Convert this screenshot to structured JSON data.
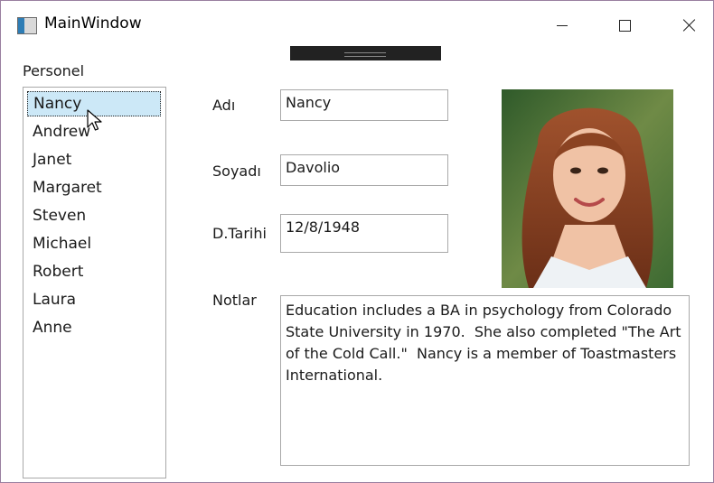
{
  "window": {
    "title": "MainWindow"
  },
  "list": {
    "label": "Personel",
    "items": [
      "Nancy",
      "Andrew",
      "Janet",
      "Margaret",
      "Steven",
      "Michael",
      "Robert",
      "Laura",
      "Anne"
    ],
    "selected_index": 0
  },
  "fields": {
    "first_name_label": "Adı",
    "first_name_value": "Nancy",
    "last_name_label": "Soyadı",
    "last_name_value": "Davolio",
    "birth_date_label": "D.Tarihi",
    "birth_date_value": "12/8/1948",
    "notes_label": "Notlar",
    "notes_value": "Education includes a BA in psychology from Colorado State University in 1970.  She also completed \"The Art of the Cold Call.\"  Nancy is a member of Toastmasters International."
  },
  "icons": {
    "app": "app-icon",
    "minimize": "minimize-icon",
    "maximize": "maximize-icon",
    "close": "close-icon",
    "cursor": "mouse-cursor-icon"
  }
}
